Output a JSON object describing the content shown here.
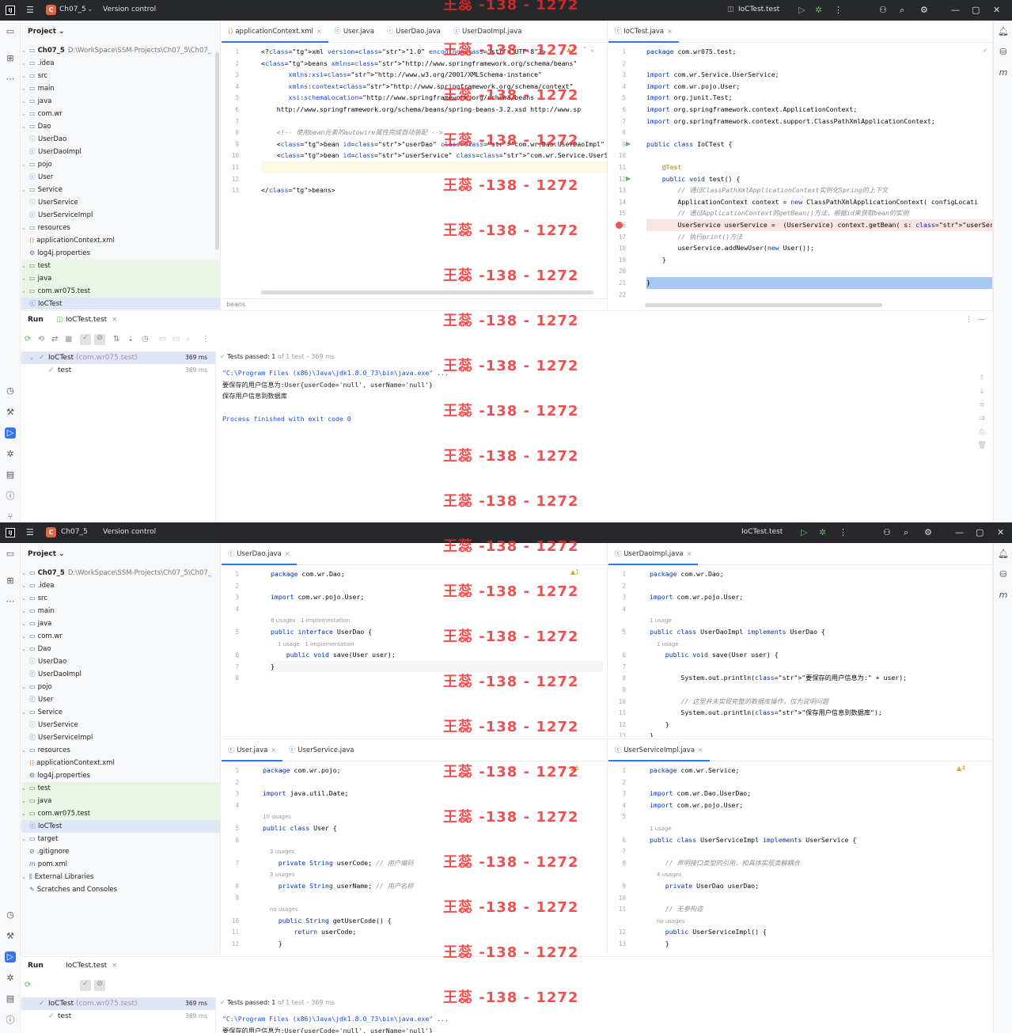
{
  "watermark": "王蕊 -138 - 1272",
  "titlebar": {
    "app_logo": "IJ",
    "project_letter": "C",
    "project": "Ch07_5",
    "vcs": "Version control",
    "run_config": "IoCTest.test"
  },
  "project_panel": {
    "title": "Project"
  },
  "tree": [
    {
      "label": "Ch07_5",
      "extra": "D:\\WorkSpace\\SSM-Projects\\Ch07_5\\Ch07_",
      "icon": "folder-icon",
      "indent": 0,
      "bold": true
    },
    {
      "label": ".idea",
      "icon": "folder-icon",
      "indent": 1
    },
    {
      "label": "src",
      "icon": "folder-icon",
      "indent": 1
    },
    {
      "label": "main",
      "icon": "folder-icon",
      "indent": 2
    },
    {
      "label": "java",
      "icon": "folder-icon",
      "indent": 3
    },
    {
      "label": "com.wr",
      "icon": "package-icon",
      "indent": 4
    },
    {
      "label": "Dao",
      "icon": "package-icon",
      "indent": 5
    },
    {
      "label": "UserDao",
      "icon": "interface-icon",
      "indent": 6
    },
    {
      "label": "UserDaoImpl",
      "icon": "class-icon",
      "indent": 6
    },
    {
      "label": "pojo",
      "icon": "package-icon",
      "indent": 5
    },
    {
      "label": "User",
      "icon": "class-icon",
      "indent": 6
    },
    {
      "label": "Service",
      "icon": "package-icon",
      "indent": 5
    },
    {
      "label": "UserService",
      "icon": "interface-icon",
      "indent": 6
    },
    {
      "label": "UserServiceImpl",
      "icon": "class-icon",
      "indent": 6
    },
    {
      "label": "resources",
      "icon": "folder-icon",
      "indent": 3
    },
    {
      "label": "applicationContext.xml",
      "icon": "xml-icon",
      "indent": 4
    },
    {
      "label": "log4j.properties",
      "icon": "properties-icon",
      "indent": 4
    },
    {
      "label": "test",
      "icon": "folder-icon",
      "indent": 2
    },
    {
      "label": "java",
      "icon": "folder-icon",
      "indent": 3
    },
    {
      "label": "com.wr075.test",
      "icon": "package-icon",
      "indent": 4
    },
    {
      "label": "IoCTest",
      "icon": "class-icon",
      "indent": 5
    },
    {
      "label": "target",
      "icon": "folder-icon",
      "indent": 1
    },
    {
      "label": ".gitignore",
      "icon": "gitignore-icon",
      "indent": 1
    },
    {
      "label": "pom.xml",
      "icon": "maven-icon",
      "indent": 1
    },
    {
      "label": "External Libraries",
      "icon": "library-icon",
      "indent": 0
    },
    {
      "label": "Scratches and Consoles",
      "icon": "scratch-icon",
      "indent": 0
    }
  ],
  "s1_tabs_left": [
    "applicationContext.xml",
    "User.java",
    "UserDao.java",
    "UserDaoImpl.java"
  ],
  "s1_tabs_right": [
    "IoCTest.java"
  ],
  "xml_lines": [
    {
      "n": "1",
      "t": "<?xml version=\"1.0\" encoding=\"UTF-8\"?>"
    },
    {
      "n": "2",
      "t": "<beans xmlns=\"http://www.springframework.org/schema/beans\""
    },
    {
      "n": "3",
      "t": "       xmlns:xsi=\"http://www.w3.org/2001/XMLSchema-instance\""
    },
    {
      "n": "4",
      "t": "       xmlns:context=\"http://www.springframework.org/schema/context\""
    },
    {
      "n": "5",
      "t": "       xsi:schemaLocation=\"http://www.springframework.org/schema/beans"
    },
    {
      "n": "6",
      "t": "    http://www.springframework.org/schema/beans/spring-beans-3.2.xsd http://www.sp"
    },
    {
      "n": "7",
      "t": ""
    },
    {
      "n": "8",
      "t": "    <!-- 使用bean元素的autowire属性完成自动装配 -->"
    },
    {
      "n": "9",
      "t": "    <bean id=\"userDao\" class=\"com.wr.Dao.UserDaoImpl\" />"
    },
    {
      "n": "10",
      "t": "    <bean id=\"userService\" class=\"com.wr.Service.UserServiceImpl\" autowire=\"byName"
    },
    {
      "n": "11",
      "t": ""
    },
    {
      "n": "12",
      "t": ""
    },
    {
      "n": "13",
      "t": "</beans>"
    }
  ],
  "xml_breadcrumb": "beans",
  "xml_warn": "4",
  "ioc_lines": [
    {
      "n": "1",
      "t": "package com.wr075.test;"
    },
    {
      "n": "2",
      "t": ""
    },
    {
      "n": "3",
      "t": "import com.wr.Service.UserService;"
    },
    {
      "n": "4",
      "t": "import com.wr.pojo.User;"
    },
    {
      "n": "5",
      "t": "import org.junit.Test;"
    },
    {
      "n": "6",
      "t": "import org.springframework.context.ApplicationContext;"
    },
    {
      "n": "7",
      "t": "import org.springframework.context.support.ClassPathXmlApplicationContext;"
    },
    {
      "n": "8",
      "t": ""
    },
    {
      "n": "9",
      "t": "public class IoCTest {"
    },
    {
      "n": "10",
      "t": ""
    },
    {
      "n": "11",
      "t": "    @Test"
    },
    {
      "n": "12",
      "t": "    public void test() {"
    },
    {
      "n": "13",
      "t": "        // 通过ClassPathXmlApplicationContext实例化Spring的上下文"
    },
    {
      "n": "14",
      "t": "        ApplicationContext context = new ClassPathXmlApplicationContext( configLocati"
    },
    {
      "n": "15",
      "t": "        // 通过ApplicationContext的getBean()方法，根据id来获取bean的实例"
    },
    {
      "n": "16",
      "t": "        UserService userService =  (UserService) context.getBean( s: \"userService\")"
    },
    {
      "n": "17",
      "t": "        // 执行print()方法"
    },
    {
      "n": "18",
      "t": "        userService.addNewUser(new User());"
    },
    {
      "n": "19",
      "t": "    }"
    },
    {
      "n": "20",
      "t": ""
    },
    {
      "n": "21",
      "t": "}"
    },
    {
      "n": "22",
      "t": ""
    }
  ],
  "run": {
    "tab_label": "Run",
    "config": "IoCTest.test",
    "root": "IoCTest",
    "root_pkg": "(com.wr075.test)",
    "root_time": "369 ms",
    "child": "test",
    "child_time": "369 ms",
    "status_prefix": "Tests passed:",
    "status_count": "1",
    "status_rest": "of 1 test – 369 ms",
    "console": [
      "\"C:\\Program Files (x86)\\Java\\jdk1.8.0_73\\bin\\java.exe\" ...",
      "要保存的用户信息为:User{userCode='null', userName='null'}",
      "保存用户信息到数据库",
      "",
      "Process finished with exit code 0"
    ]
  },
  "s2_tabs": {
    "tl": [
      "UserDao.java"
    ],
    "tr": [
      "UserDaoImpl.java"
    ],
    "bl": [
      "User.java",
      "UserService.java"
    ],
    "br": [
      "UserServiceImpl.java"
    ]
  },
  "userdao_lines": [
    {
      "n": "1",
      "t": "package com.wr.Dao;"
    },
    {
      "n": "2",
      "t": ""
    },
    {
      "n": "3",
      "t": "import com.wr.pojo.User;"
    },
    {
      "n": "4",
      "t": ""
    },
    {
      "n": "",
      "t": "6 usages   1 implementation"
    },
    {
      "n": "5",
      "t": "public interface UserDao {"
    },
    {
      "n": "",
      "t": "    1 usage   1 implementation"
    },
    {
      "n": "6",
      "t": "    public void save(User user);"
    },
    {
      "n": "7",
      "t": "}"
    },
    {
      "n": "8",
      "t": ""
    }
  ],
  "userdao_warn": "1",
  "userdaoimpl_lines": [
    {
      "n": "1",
      "t": "package com.wr.Dao;"
    },
    {
      "n": "2",
      "t": ""
    },
    {
      "n": "3",
      "t": "import com.wr.pojo.User;"
    },
    {
      "n": "4",
      "t": ""
    },
    {
      "n": "",
      "t": "1 usage"
    },
    {
      "n": "5",
      "t": "public class UserDaoImpl implements UserDao {"
    },
    {
      "n": "",
      "t": "    1 usage"
    },
    {
      "n": "6",
      "t": "    public void save(User user) {"
    },
    {
      "n": "7",
      "t": ""
    },
    {
      "n": "8",
      "t": "        System.out.println(\"要保存的用户信息为:\" + user);"
    },
    {
      "n": "9",
      "t": ""
    },
    {
      "n": "10",
      "t": "        // 这里并未实现完整的数据库操作，仅为说明问题"
    },
    {
      "n": "11",
      "t": "        System.out.println(\"保存用户信息到数据库\");"
    },
    {
      "n": "12",
      "t": "    }"
    },
    {
      "n": "13",
      "t": "}"
    }
  ],
  "user_lines": [
    {
      "n": "1",
      "t": "package com.wr.pojo;"
    },
    {
      "n": "2",
      "t": ""
    },
    {
      "n": "3",
      "t": "import java.util.Date;"
    },
    {
      "n": "4",
      "t": ""
    },
    {
      "n": "",
      "t": "10 usages"
    },
    {
      "n": "5",
      "t": "public class User {"
    },
    {
      "n": "6",
      "t": ""
    },
    {
      "n": "",
      "t": "    3 usages"
    },
    {
      "n": "7",
      "t": "    private String userCode; // 用户编码"
    },
    {
      "n": "",
      "t": "    3 usages"
    },
    {
      "n": "8",
      "t": "    private String userName; // 用户名称"
    },
    {
      "n": "9",
      "t": ""
    },
    {
      "n": "",
      "t": "    no usages"
    },
    {
      "n": "10",
      "t": "    public String getUserCode() {"
    },
    {
      "n": "11",
      "t": "        return userCode;"
    },
    {
      "n": "12",
      "t": "    }"
    }
  ],
  "user_warn": "5",
  "usi_lines": [
    {
      "n": "1",
      "t": "package com.wr.Service;"
    },
    {
      "n": "2",
      "t": ""
    },
    {
      "n": "3",
      "t": "import com.wr.Dao.UserDao;"
    },
    {
      "n": "4",
      "t": "import com.wr.pojo.User;"
    },
    {
      "n": "5",
      "t": ""
    },
    {
      "n": "",
      "t": "1 usage"
    },
    {
      "n": "6",
      "t": "public class UserServiceImpl implements UserService {"
    },
    {
      "n": "7",
      "t": ""
    },
    {
      "n": "8",
      "t": "    // 声明接口类型的引用，和具体实现类解耦合"
    },
    {
      "n": "",
      "t": "    4 usages"
    },
    {
      "n": "9",
      "t": "    private UserDao userDao;"
    },
    {
      "n": "10",
      "t": ""
    },
    {
      "n": "11",
      "t": "    // 无参构造"
    },
    {
      "n": "",
      "t": "    no usages"
    },
    {
      "n": "12",
      "t": "    public UserServiceImpl() {"
    },
    {
      "n": "13",
      "t": "    }"
    }
  ],
  "usi_warn": "4"
}
